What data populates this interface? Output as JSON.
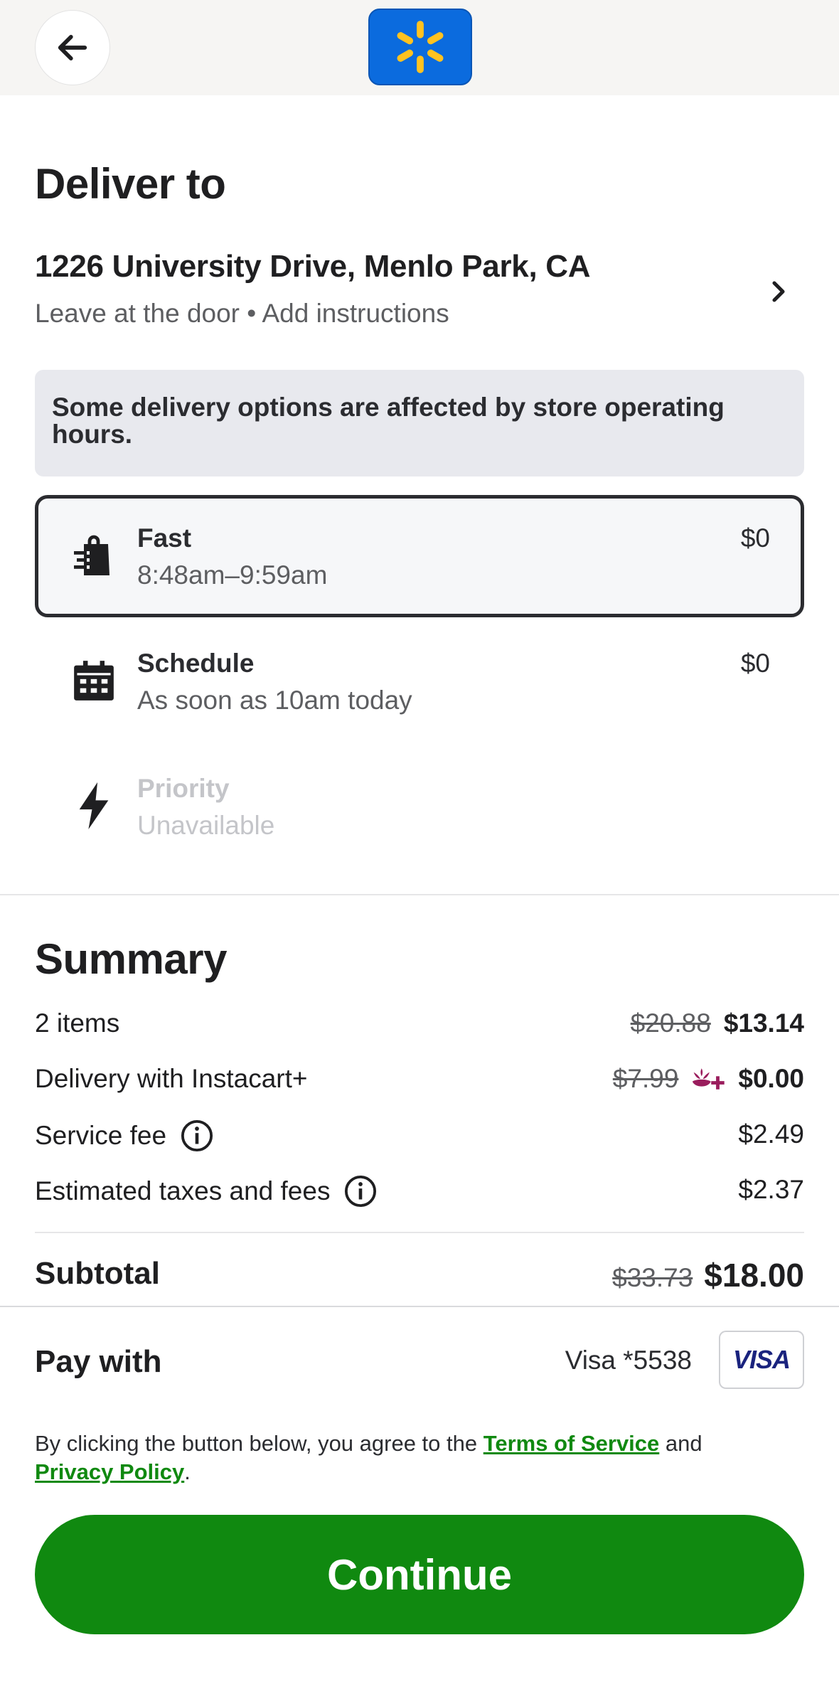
{
  "header": {
    "back_icon": "arrow-left-icon",
    "logo_icon": "walmart-spark-icon",
    "logo_color": "#0b6bde",
    "spark_color": "#ffc220"
  },
  "delivery": {
    "title": "Deliver to",
    "address": "1226 University Drive, Menlo Park, CA",
    "instructions": "Leave at the door • Add instructions",
    "notice": "Some delivery options are affected by store operating hours.",
    "options": [
      {
        "title": "Fast",
        "subtitle": "8:48am–9:59am",
        "price": "$0",
        "icon": "shopping-bag-fast-icon",
        "selected": true
      },
      {
        "title": "Schedule",
        "subtitle": "As soon as 10am today",
        "price": "$0",
        "icon": "calendar-icon",
        "selected": false
      },
      {
        "title": "Priority",
        "subtitle": "Unavailable",
        "price": "",
        "icon": "lightning-icon",
        "selected": false,
        "disabled": true
      }
    ]
  },
  "summary": {
    "title": "Summary",
    "items": {
      "label": "2 items",
      "original": "$20.88",
      "value": "$13.14"
    },
    "delivery": {
      "label": "Delivery with Instacart+",
      "original": "$7.99",
      "value": "$0.00",
      "icon": "instacart-plus-icon",
      "icon_color": "#9a1d5d"
    },
    "service_fee": {
      "label": "Service fee",
      "value": "$2.49"
    },
    "taxes": {
      "label": "Estimated taxes and fees",
      "value": "$2.37"
    },
    "subtotal": {
      "label": "Subtotal",
      "original": "$33.73",
      "value": "$18.00"
    }
  },
  "payment": {
    "label": "Pay with",
    "card": "Visa *5538",
    "brand": "VISA"
  },
  "legal": {
    "prefix": "By clicking the button below, you agree to the ",
    "tos": "Terms of Service",
    "middle": " and ",
    "privacy": "Privacy Policy",
    "suffix": "."
  },
  "cta": {
    "label": "Continue",
    "color": "#108910"
  }
}
